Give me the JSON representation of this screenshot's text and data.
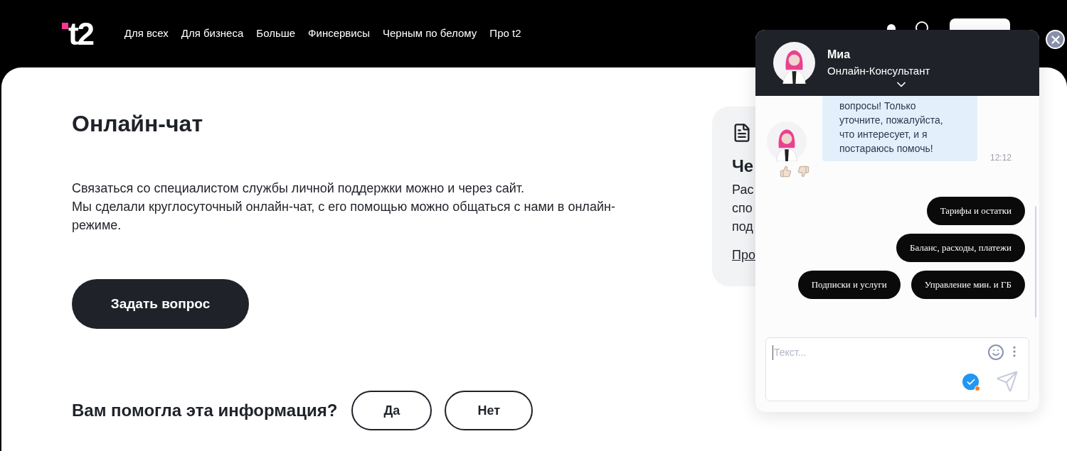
{
  "header": {
    "logo": "t2",
    "nav": [
      {
        "label": "Для всех"
      },
      {
        "label": "Для бизнеса"
      },
      {
        "label": "Больше"
      },
      {
        "label": "Финсервисы"
      },
      {
        "label": "Черным по белому"
      },
      {
        "label": "Про t2"
      }
    ]
  },
  "main": {
    "title": "Онлайн-чат",
    "paragraph": [
      "Связаться со специалистом службы личной поддержки можно и через сайт.",
      "Мы сделали круглосуточный онлайн-чат, с его помощью можно общаться с нами в онлайн-режиме."
    ],
    "ask_button": "Задать вопрос",
    "feedback": {
      "question": "Вам помогла эта информация?",
      "buttons": [
        "Да",
        "Нет"
      ]
    }
  },
  "side_card": {
    "title": "Че",
    "lines": [
      "Рас",
      "спо",
      "под"
    ],
    "link": "Про"
  },
  "chat": {
    "agent_name": "Миа",
    "agent_role": "Онлайн-Консультант",
    "message": {
      "text": "вопросы! Только уточните, пожалуйста, что интересует, и я постараюсь помочь!",
      "time": "12:12"
    },
    "quick_replies": [
      [
        "Тарифы и остатки"
      ],
      [
        "Баланс, расходы, платежи"
      ],
      [
        "Подписки и услуги",
        "Управление мин. и ГБ"
      ]
    ],
    "input": {
      "placeholder": "Текст..."
    }
  }
}
